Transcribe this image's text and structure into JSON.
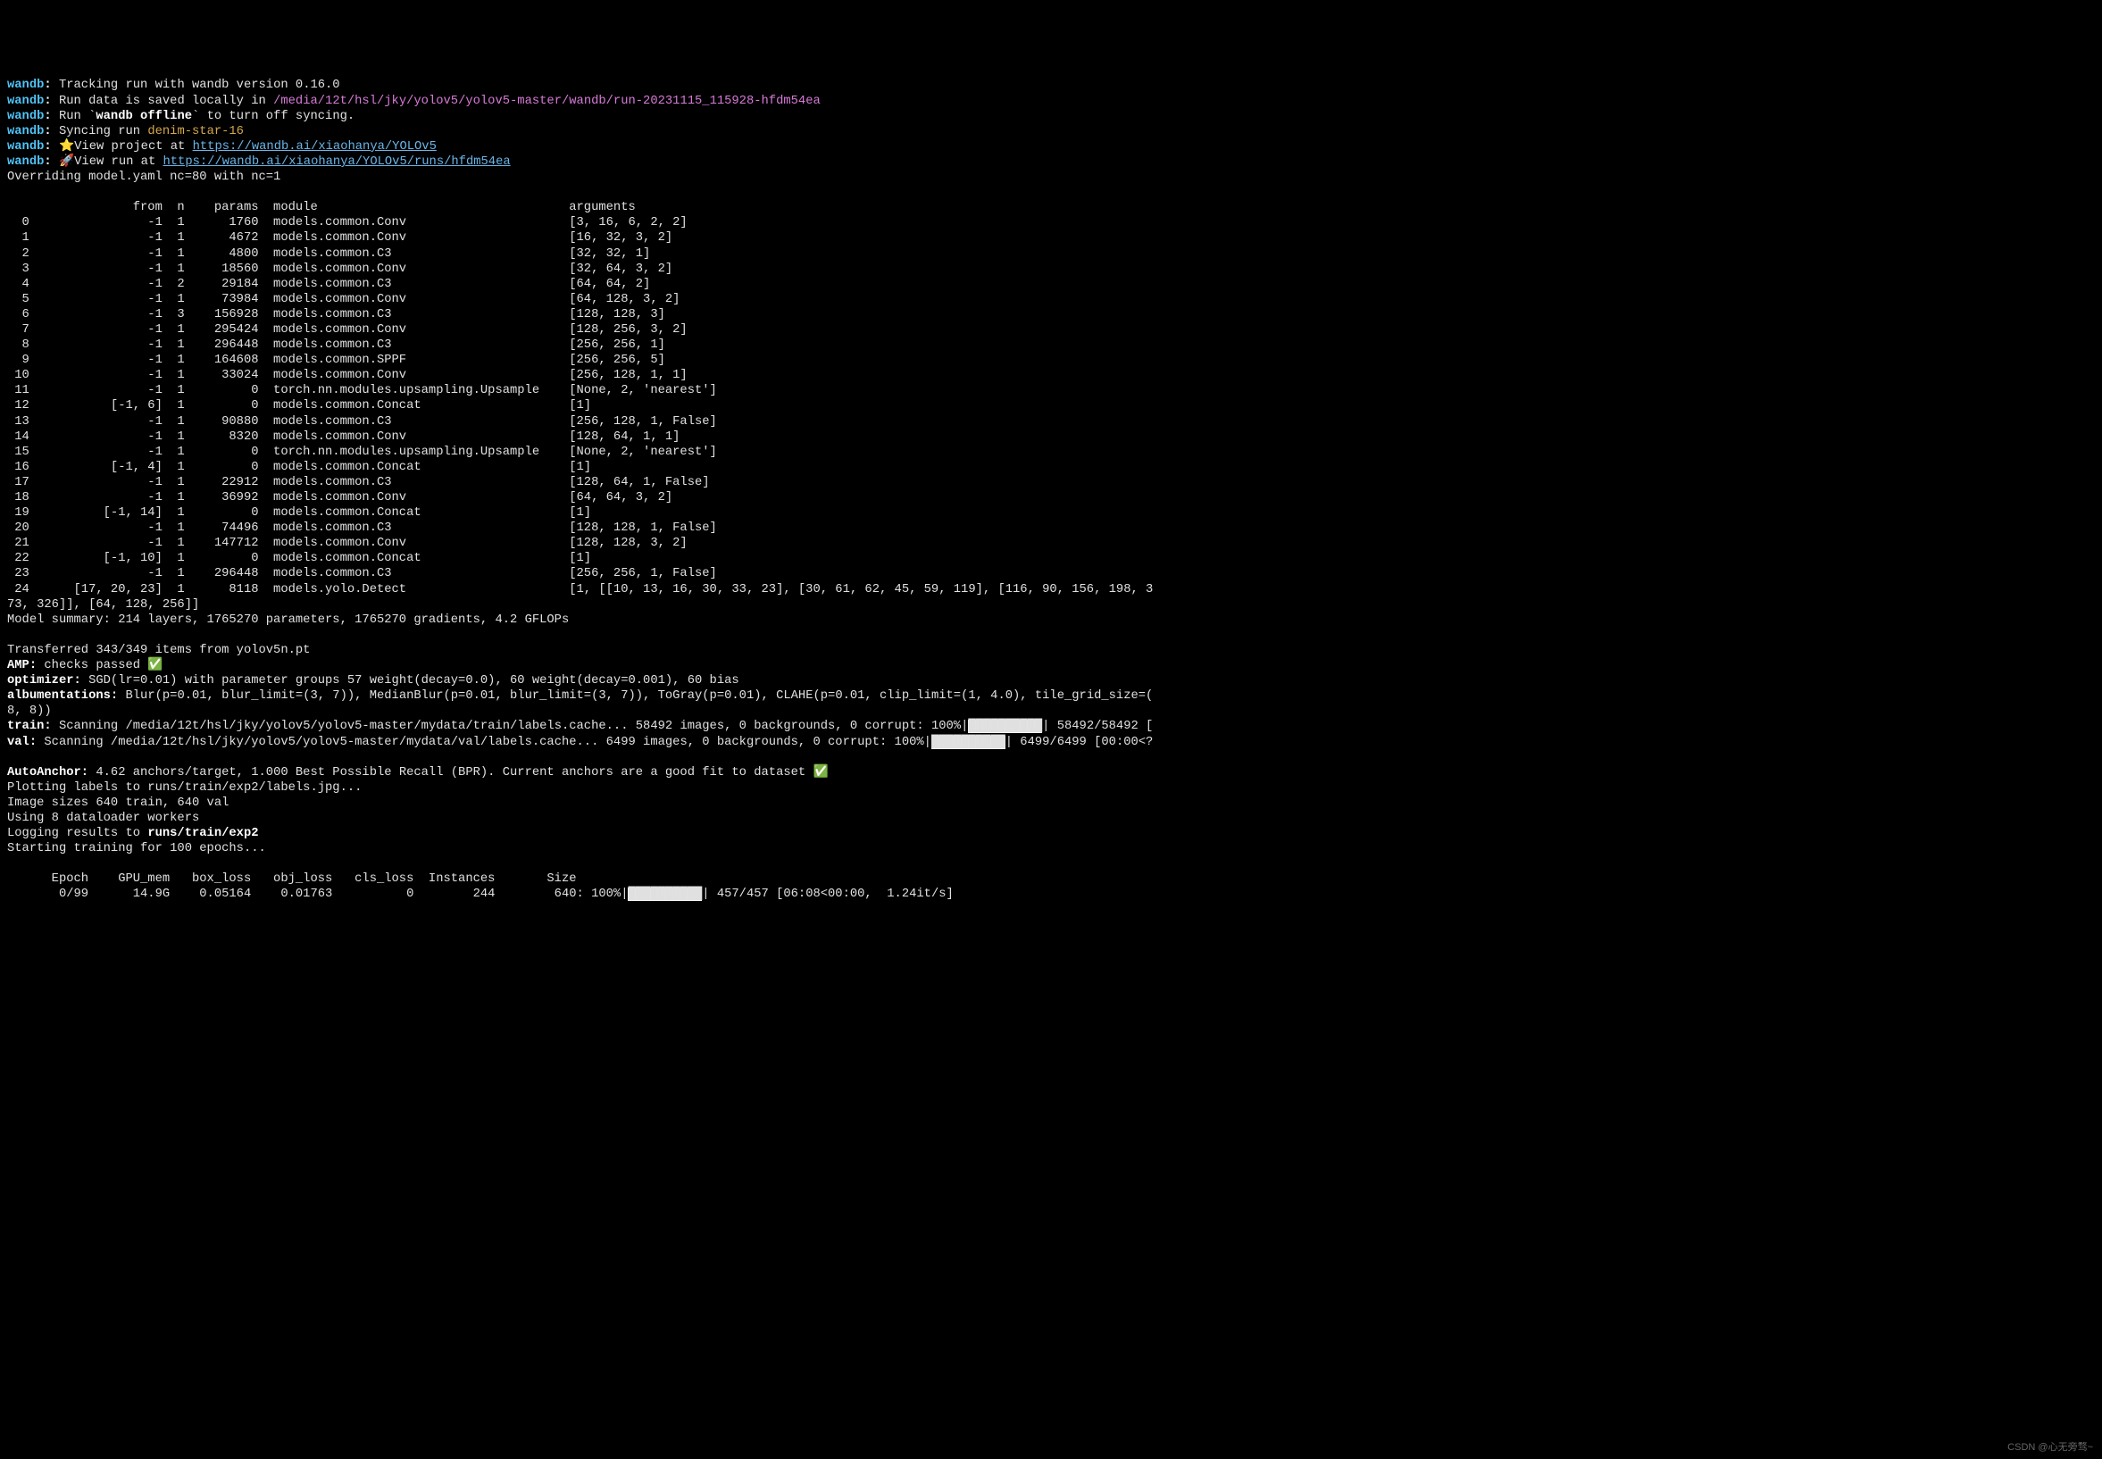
{
  "wandb": {
    "label": "wandb",
    "version_line": " Tracking run with wandb version 0.16.0",
    "run_data_prefix": " Run data is saved locally in ",
    "run_data_path": "/media/12t/hsl/jky/yolov5/yolov5-master/wandb/run-20231115_115928-hfdm54ea",
    "offline_line": " Run `",
    "offline_cmd": "wandb offline",
    "offline_suffix": "` to turn off syncing.",
    "syncing_prefix": " Syncing run ",
    "run_name": "denim-star-16",
    "project_prefix": " ⭐View project at ",
    "project_url": "https://wandb.ai/xiaohanya/YOLOv5",
    "run_prefix": " 🚀View run at ",
    "run_url": "https://wandb.ai/xiaohanya/YOLOv5/runs/hfdm54ea"
  },
  "override_line": "Overriding model.yaml nc=80 with nc=1",
  "table": {
    "header": "                 from  n    params  module                                  arguments",
    "rows": [
      "  0                -1  1      1760  models.common.Conv                      [3, 16, 6, 2, 2]",
      "  1                -1  1      4672  models.common.Conv                      [16, 32, 3, 2]",
      "  2                -1  1      4800  models.common.C3                        [32, 32, 1]",
      "  3                -1  1     18560  models.common.Conv                      [32, 64, 3, 2]",
      "  4                -1  2     29184  models.common.C3                        [64, 64, 2]",
      "  5                -1  1     73984  models.common.Conv                      [64, 128, 3, 2]",
      "  6                -1  3    156928  models.common.C3                        [128, 128, 3]",
      "  7                -1  1    295424  models.common.Conv                      [128, 256, 3, 2]",
      "  8                -1  1    296448  models.common.C3                        [256, 256, 1]",
      "  9                -1  1    164608  models.common.SPPF                      [256, 256, 5]",
      " 10                -1  1     33024  models.common.Conv                      [256, 128, 1, 1]",
      " 11                -1  1         0  torch.nn.modules.upsampling.Upsample    [None, 2, 'nearest']",
      " 12           [-1, 6]  1         0  models.common.Concat                    [1]",
      " 13                -1  1     90880  models.common.C3                        [256, 128, 1, False]",
      " 14                -1  1      8320  models.common.Conv                      [128, 64, 1, 1]",
      " 15                -1  1         0  torch.nn.modules.upsampling.Upsample    [None, 2, 'nearest']",
      " 16           [-1, 4]  1         0  models.common.Concat                    [1]",
      " 17                -1  1     22912  models.common.C3                        [128, 64, 1, False]",
      " 18                -1  1     36992  models.common.Conv                      [64, 64, 3, 2]",
      " 19          [-1, 14]  1         0  models.common.Concat                    [1]",
      " 20                -1  1     74496  models.common.C3                        [128, 128, 1, False]",
      " 21                -1  1    147712  models.common.Conv                      [128, 128, 3, 2]",
      " 22          [-1, 10]  1         0  models.common.Concat                    [1]",
      " 23                -1  1    296448  models.common.C3                        [256, 256, 1, False]",
      " 24      [17, 20, 23]  1      8118  models.yolo.Detect                      [1, [[10, 13, 16, 30, 33, 23], [30, 61, 62, 45, 59, 119], [116, 90, 156, 198, 3"
    ],
    "row24_cont": "73, 326]], [64, 128, 256]]"
  },
  "model_summary": "Model summary: 214 layers, 1765270 parameters, 1765270 gradients, 4.2 GFLOPs",
  "transferred": "Transferred 343/349 items from yolov5n.pt",
  "amp": {
    "label": "AMP:",
    "text": " checks passed ",
    "check": "✅"
  },
  "optimizer": {
    "label": "optimizer:",
    "text": " SGD(lr=0.01) with parameter groups 57 weight(decay=0.0), 60 weight(decay=0.001), 60 bias"
  },
  "albumentations": {
    "label": "albumentations:",
    "text": " Blur(p=0.01, blur_limit=(3, 7)), MedianBlur(p=0.01, blur_limit=(3, 7)), ToGray(p=0.01), CLAHE(p=0.01, clip_limit=(1, 4.0), tile_grid_size=(",
    "cont": "8, 8))"
  },
  "train": {
    "label": "train:",
    "text": " Scanning /media/12t/hsl/jky/yolov5/yolov5-master/mydata/train/labels.cache... 58492 images, 0 backgrounds, 0 corrupt: 100%|",
    "bar": "██████████",
    "suffix": "| 58492/58492 ["
  },
  "val": {
    "label": "val:",
    "text": " Scanning /media/12t/hsl/jky/yolov5/yolov5-master/mydata/val/labels.cache... 6499 images, 0 backgrounds, 0 corrupt: 100%|",
    "bar": "██████████",
    "suffix": "| 6499/6499 [00:00<?"
  },
  "autoanchor": {
    "label": "AutoAnchor:",
    "text": " 4.62 anchors/target, 1.000 Best Possible Recall (BPR). Current anchors are a good fit to dataset ",
    "check": "✅"
  },
  "plotting": "Plotting labels to runs/train/exp2/labels.jpg...",
  "image_sizes": "Image sizes 640 train, 640 val",
  "workers": "Using 8 dataloader workers",
  "logging_prefix": "Logging results to ",
  "logging_path": "runs/train/exp2",
  "starting": "Starting training for 100 epochs...",
  "training_header": "      Epoch    GPU_mem   box_loss   obj_loss   cls_loss  Instances       Size",
  "training_row_prefix": "       0/99      14.9G    0.05164    0.01763          0        244        640: 100%|",
  "training_bar": "██████████",
  "training_suffix": "| 457/457 [06:08<00:00,  1.24it/s]",
  "watermark": "CSDN @心无旁骛~"
}
